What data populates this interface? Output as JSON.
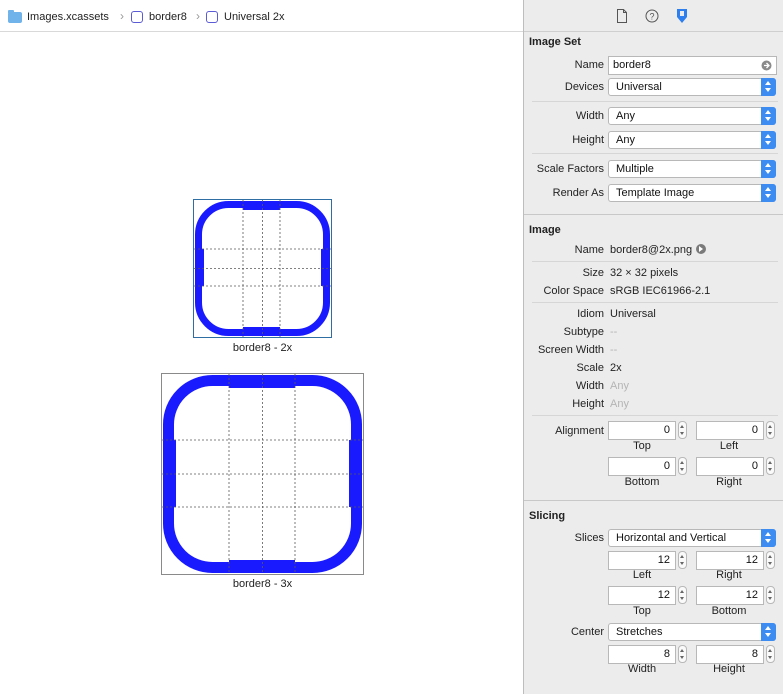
{
  "breadcrumb": {
    "items": [
      "Images.xcassets",
      "border8",
      "Universal 2x"
    ],
    "separator": "›"
  },
  "canvas": {
    "tiles": [
      {
        "caption": "border8 - 2x"
      },
      {
        "caption": "border8 - 3x"
      }
    ],
    "accent": "#1a1aff"
  },
  "inspector": {
    "toolbar_icons": [
      "file-icon",
      "help-icon",
      "attributes-icon"
    ],
    "image_set": {
      "header": "Image Set",
      "name_label": "Name",
      "name_value": "border8",
      "devices_label": "Devices",
      "devices_value": "Universal",
      "width_label": "Width",
      "width_value": "Any",
      "height_label": "Height",
      "height_value": "Any",
      "scale_label": "Scale Factors",
      "scale_value": "Multiple",
      "render_label": "Render As",
      "render_value": "Template Image"
    },
    "image": {
      "header": "Image",
      "name_label": "Name",
      "name_value": "border8@2x.png",
      "size_label": "Size",
      "size_value": "32 × 32 pixels",
      "colorspace_label": "Color Space",
      "colorspace_value": "sRGB IEC61966-2.1",
      "idiom_label": "Idiom",
      "idiom_value": "Universal",
      "subtype_label": "Subtype",
      "subtype_value": "--",
      "screenwidth_label": "Screen Width",
      "screenwidth_value": "--",
      "scale_label": "Scale",
      "scale_value": "2x",
      "width_label": "Width",
      "width_value": "Any",
      "height_label": "Height",
      "height_value": "Any",
      "alignment_label": "Alignment",
      "alignment": {
        "top": "0",
        "left": "0",
        "bottom": "0",
        "right": "0"
      },
      "alignment_sub": {
        "top": "Top",
        "left": "Left",
        "bottom": "Bottom",
        "right": "Right"
      }
    },
    "slicing": {
      "header": "Slicing",
      "slices_label": "Slices",
      "slices_value": "Horizontal and Vertical",
      "insets": {
        "left": "12",
        "right": "12",
        "top": "12",
        "bottom": "12"
      },
      "insets_sub": {
        "left": "Left",
        "right": "Right",
        "top": "Top",
        "bottom": "Bottom"
      },
      "center_label": "Center",
      "center_value": "Stretches",
      "center_size": {
        "width": "8",
        "height": "8"
      },
      "center_sub": {
        "width": "Width",
        "height": "Height"
      }
    },
    "accent": "#3c8cf2"
  }
}
